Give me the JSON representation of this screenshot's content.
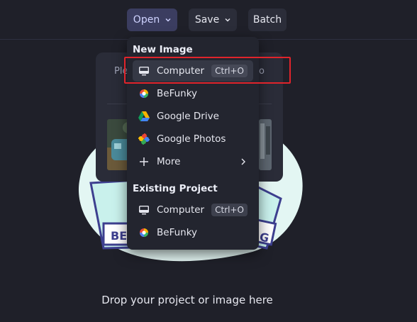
{
  "toolbar": {
    "open_label": "Open",
    "save_label": "Save",
    "batch_label": "Batch"
  },
  "card": {
    "text_left": "Ple",
    "text_right": "o"
  },
  "illustration": {
    "sign_left": "BE",
    "sign_right": "G"
  },
  "dropzone": {
    "text": "Drop your project or image here"
  },
  "menu": {
    "new_image_title": "New Image",
    "new_image_items": [
      {
        "label": "Computer",
        "shortcut": "Ctrl+O",
        "icon": "monitor-icon"
      },
      {
        "label": "BeFunky",
        "icon": "befunky-icon"
      },
      {
        "label": "Google Drive",
        "icon": "google-drive-icon"
      },
      {
        "label": "Google Photos",
        "icon": "google-photos-icon"
      },
      {
        "label": "More",
        "icon": "plus-icon"
      }
    ],
    "existing_title": "Existing Project",
    "existing_items": [
      {
        "label": "Computer",
        "shortcut": "Ctrl+O",
        "icon": "monitor-icon"
      },
      {
        "label": "BeFunky",
        "icon": "befunky-icon"
      }
    ]
  },
  "colors": {
    "background": "#1f2029",
    "menu_bg": "#23252f",
    "active_button": "#3b3d60",
    "highlight_box": "#e0242b",
    "blob": "#e3f6f3"
  }
}
